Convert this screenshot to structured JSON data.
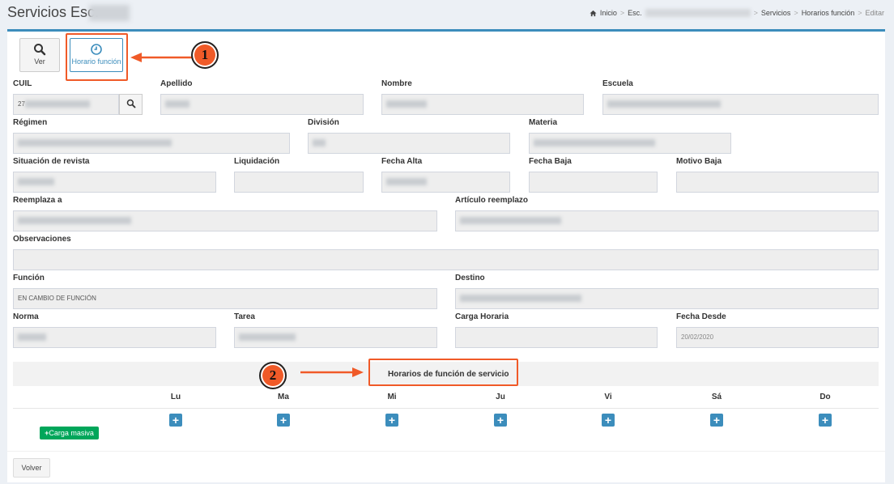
{
  "header": {
    "title": "Servicios Esc.",
    "breadcrumb": {
      "home": "Inicio",
      "school": "Esc.",
      "servicios": "Servicios",
      "horarios": "Horarios función",
      "current": "Editar"
    }
  },
  "toolbar": {
    "ver_label": "Ver",
    "horario_label": "Horario función"
  },
  "annotations": {
    "marker_1": "1",
    "marker_2": "2"
  },
  "form": {
    "cuil": {
      "label": "CUIL",
      "value": "27"
    },
    "apellido": {
      "label": "Apellido",
      "value": ""
    },
    "nombre": {
      "label": "Nombre",
      "value": ""
    },
    "escuela": {
      "label": "Escuela",
      "value": ""
    },
    "regimen": {
      "label": "Régimen",
      "value": ""
    },
    "division": {
      "label": "División",
      "value": ""
    },
    "materia": {
      "label": "Materia",
      "value": ""
    },
    "situacion": {
      "label": "Situación de revista",
      "value": ""
    },
    "liquidacion": {
      "label": "Liquidación",
      "value": ""
    },
    "fecha_alta": {
      "label": "Fecha Alta",
      "value": ""
    },
    "fecha_baja": {
      "label": "Fecha Baja",
      "value": ""
    },
    "motivo_baja": {
      "label": "Motivo Baja",
      "value": ""
    },
    "reemplaza": {
      "label": "Reemplaza a",
      "value": ""
    },
    "articulo": {
      "label": "Artículo reemplazo",
      "value": ""
    },
    "observaciones": {
      "label": "Observaciones",
      "value": ""
    },
    "funcion": {
      "label": "Función",
      "value": "EN CAMBIO DE FUNCIÓN"
    },
    "destino": {
      "label": "Destino",
      "value": ""
    },
    "norma": {
      "label": "Norma",
      "value": ""
    },
    "tarea": {
      "label": "Tarea",
      "value": ""
    },
    "carga_horaria": {
      "label": "Carga Horaria",
      "value": ""
    },
    "fecha_desde": {
      "label": "Fecha Desde",
      "value": "20/02/2020"
    }
  },
  "schedule": {
    "title": "Horarios de función de servicio",
    "days": [
      "Lu",
      "Ma",
      "Mi",
      "Ju",
      "Vi",
      "Sá",
      "Do"
    ],
    "carga_masiva_label": "Carga masiva"
  },
  "footer": {
    "volver_label": "Volver"
  },
  "colors": {
    "accent": "#3c8dbc",
    "success": "#00a65a",
    "highlight": "#f05a28"
  }
}
